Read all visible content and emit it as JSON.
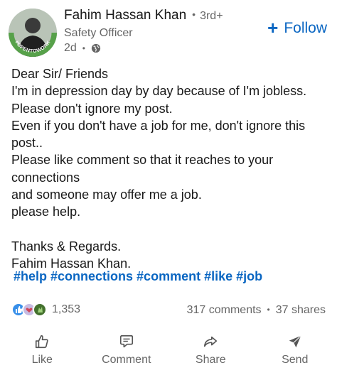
{
  "author": {
    "name": "Fahim Hassan Khan",
    "degree": "3rd+",
    "headline": "Safety Officer",
    "time": "2d",
    "visibility_icon": "globe-icon",
    "avatar_badge": "#OPENTOWORK"
  },
  "follow_label": "Follow",
  "post": {
    "lines": [
      "Dear Sir/ Friends",
      "I'm in depression day by day because of I'm jobless.",
      "Please don't ignore my post.",
      "Even if you don't have a job for me, don't ignore this",
      "post..",
      "Please like comment so that it reaches to your",
      "connections",
      "and someone may offer me a job.",
      "please help.",
      "",
      "Thanks & Regards.",
      "Fahim Hassan Khan."
    ],
    "hashtags": [
      "#help",
      "#connections",
      "#comment",
      "#like",
      "#job"
    ]
  },
  "social": {
    "reaction_count": "1,353",
    "comments": "317 comments",
    "shares": "37 shares"
  },
  "actions": {
    "like": "Like",
    "comment": "Comment",
    "share": "Share",
    "send": "Send"
  },
  "colors": {
    "link_blue": "#0a66c2",
    "meta_gray": "#666666",
    "open_to_work_green": "#57a14a"
  }
}
